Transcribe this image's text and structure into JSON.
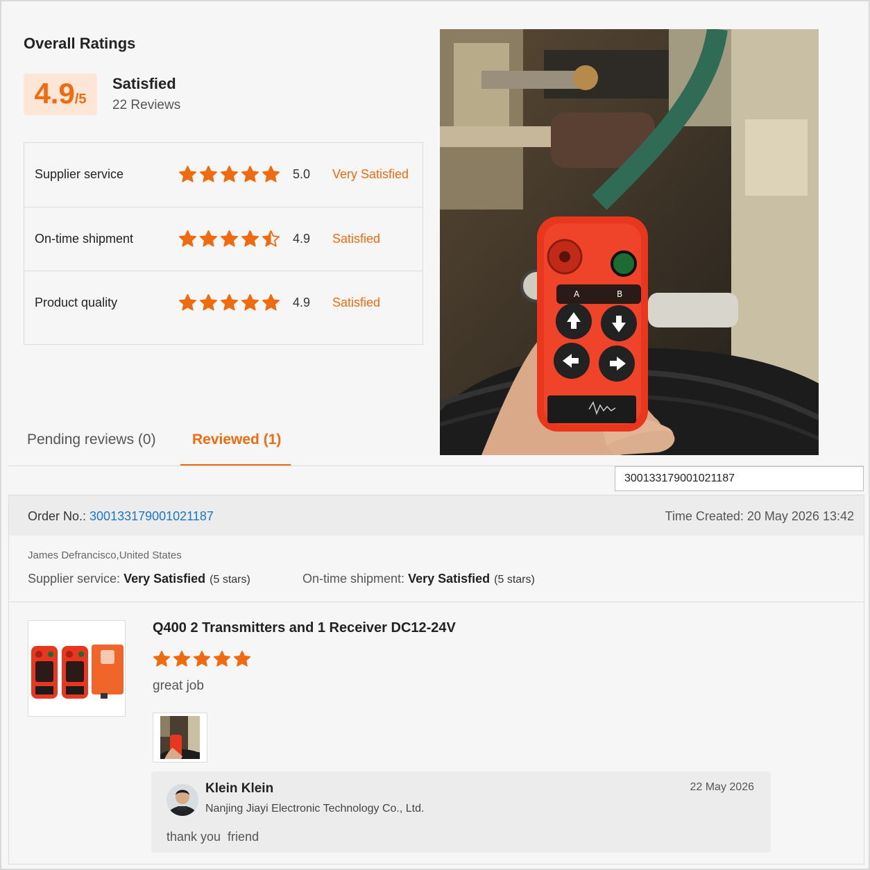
{
  "overall": {
    "title": "Overall Ratings",
    "score": "4.9",
    "score_out_of": "/5",
    "status": "Satisfied",
    "review_count": "22 Reviews"
  },
  "ratings": [
    {
      "label": "Supplier service",
      "stars": 5,
      "value": "5.0",
      "text": "Very Satisfied"
    },
    {
      "label": "On-time shipment",
      "stars": 4.5,
      "value": "4.9",
      "text": "Satisfied"
    },
    {
      "label": "Product quality",
      "stars": 5,
      "value": "4.9",
      "text": "Satisfied"
    }
  ],
  "tabs": {
    "pending": "Pending reviews (0)",
    "reviewed": "Reviewed (1)"
  },
  "search": {
    "value": "300133179001021187"
  },
  "order": {
    "no_label": "Order No.: ",
    "no_value": "300133179001021187",
    "time_created": "Time Created: 20 May 2026 13:42",
    "buyer": "James Defrancisco,United States",
    "supplier_service_label": "Supplier service: ",
    "supplier_service_value": "Very Satisfied",
    "supplier_service_stars": "(5 stars)",
    "shipment_label": "On-time shipment: ",
    "shipment_value": "Very Satisfied",
    "shipment_stars": "(5 stars)"
  },
  "product": {
    "title": "Q400 2 Transmitters and 1 Receiver DC12-24V",
    "stars": 5,
    "review": "great job"
  },
  "reply": {
    "name": "Klein Klein",
    "company": "Nanjing Jiayi Electronic Technology Co., Ltd.",
    "date": "22 May 2026",
    "text": "thank you  friend"
  },
  "colors": {
    "accent": "#f06a0f",
    "link": "#1677c8",
    "score_bg": "#fde6d6"
  }
}
